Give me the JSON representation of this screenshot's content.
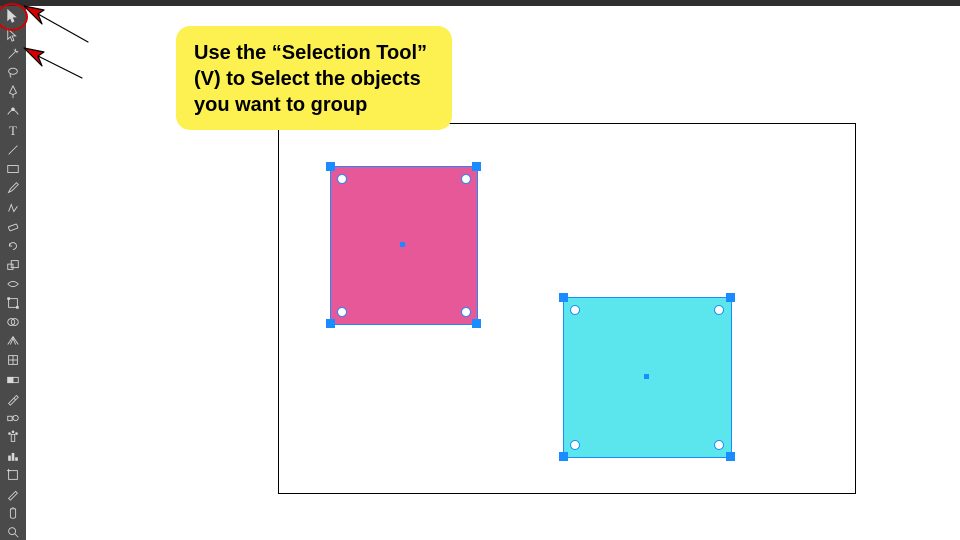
{
  "callout_text": "Use the “Selection Tool” (V) to Select the objects you want to group",
  "tools": [
    {
      "name": "selection-tool",
      "icon": "cursor"
    },
    {
      "name": "direct-selection-tool",
      "icon": "cursor-white"
    },
    {
      "name": "magic-wand-tool",
      "icon": "wand"
    },
    {
      "name": "lasso-tool",
      "icon": "lasso"
    },
    {
      "name": "pen-tool",
      "icon": "pen"
    },
    {
      "name": "curvature-tool",
      "icon": "curve"
    },
    {
      "name": "type-tool",
      "icon": "T"
    },
    {
      "name": "line-tool",
      "icon": "line"
    },
    {
      "name": "rectangle-tool",
      "icon": "rect"
    },
    {
      "name": "paintbrush-tool",
      "icon": "brush"
    },
    {
      "name": "shaper-tool",
      "icon": "shaper"
    },
    {
      "name": "eraser-tool",
      "icon": "eraser"
    },
    {
      "name": "rotate-tool",
      "icon": "rotate"
    },
    {
      "name": "scale-tool",
      "icon": "scale"
    },
    {
      "name": "width-tool",
      "icon": "width"
    },
    {
      "name": "free-transform-tool",
      "icon": "transform"
    },
    {
      "name": "shape-builder-tool",
      "icon": "shapebuild"
    },
    {
      "name": "perspective-grid-tool",
      "icon": "persp"
    },
    {
      "name": "mesh-tool",
      "icon": "mesh"
    },
    {
      "name": "gradient-tool",
      "icon": "gradient"
    },
    {
      "name": "eyedropper-tool",
      "icon": "eyedrop"
    },
    {
      "name": "blend-tool",
      "icon": "blend"
    },
    {
      "name": "symbol-sprayer-tool",
      "icon": "spray"
    },
    {
      "name": "column-graph-tool",
      "icon": "graph"
    },
    {
      "name": "artboard-tool",
      "icon": "artboard"
    },
    {
      "name": "slice-tool",
      "icon": "slice"
    },
    {
      "name": "hand-tool",
      "icon": "hand"
    },
    {
      "name": "zoom-tool",
      "icon": "zoom"
    }
  ],
  "shapes": {
    "pink": {
      "color": "#e75898"
    },
    "cyan": {
      "color": "#5be6ed"
    }
  }
}
